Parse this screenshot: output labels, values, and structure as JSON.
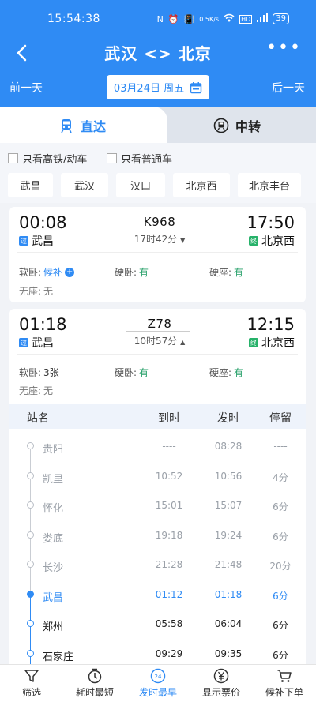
{
  "status_bar": {
    "time": "15:54:38",
    "icons": [
      "N",
      "⏰",
      "📳",
      "0.5K/s",
      "wifi",
      "HD",
      "4G"
    ],
    "battery": "39"
  },
  "header": {
    "title": "武汉 <> 北京",
    "back_icon": "back-arrow-icon",
    "more_icon": "more-dots-icon"
  },
  "date_bar": {
    "prev": "前一天",
    "date": "03月24日 周五",
    "next": "后一天"
  },
  "tabs": [
    {
      "label": "直达",
      "active": true
    },
    {
      "label": "中转",
      "active": false
    }
  ],
  "filters": [
    {
      "label": "只看高铁/动车"
    },
    {
      "label": "只看普通车"
    }
  ],
  "station_chips": [
    "武昌",
    "武汉",
    "汉口",
    "北京西",
    "北京丰台"
  ],
  "trains": [
    {
      "train_no": "K968",
      "dep_time": "00:08",
      "arr_time": "17:50",
      "dep_station": "武昌",
      "arr_station": "北京西",
      "duration": "17时42分",
      "dep_badge": "过",
      "arr_badge": "终",
      "expand_icon": "▼",
      "seats": [
        {
          "label": "软卧:",
          "value": "候补"
        },
        {
          "label": "硬卧:",
          "value": "有"
        },
        {
          "label": "硬座:",
          "value": "有"
        },
        {
          "label": "无座:",
          "value": "无"
        }
      ]
    },
    {
      "train_no": "Z78",
      "dep_time": "01:18",
      "arr_time": "12:15",
      "dep_station": "武昌",
      "arr_station": "北京西",
      "duration": "10时57分",
      "dep_badge": "过",
      "arr_badge": "终",
      "expand_icon": "▲",
      "seats": [
        {
          "label": "软卧:",
          "value": "3张"
        },
        {
          "label": "硬卧:",
          "value": "有"
        },
        {
          "label": "硬座:",
          "value": "有"
        },
        {
          "label": "无座:",
          "value": "无"
        }
      ]
    }
  ],
  "stops_table": {
    "headers": [
      "站名",
      "到时",
      "发时",
      "停留"
    ],
    "rows": [
      {
        "name": "贵阳",
        "arr": "----",
        "dep": "08:28",
        "stay": "----",
        "state": "past"
      },
      {
        "name": "凯里",
        "arr": "10:52",
        "dep": "10:56",
        "stay": "4分",
        "state": "past"
      },
      {
        "name": "怀化",
        "arr": "15:01",
        "dep": "15:07",
        "stay": "6分",
        "state": "past"
      },
      {
        "name": "娄底",
        "arr": "19:18",
        "dep": "19:24",
        "stay": "6分",
        "state": "past"
      },
      {
        "name": "长沙",
        "arr": "21:28",
        "dep": "21:48",
        "stay": "20分",
        "state": "past"
      },
      {
        "name": "武昌",
        "arr": "01:12",
        "dep": "01:18",
        "stay": "6分",
        "state": "current"
      },
      {
        "name": "郑州",
        "arr": "05:58",
        "dep": "06:04",
        "stay": "6分",
        "state": "future"
      },
      {
        "name": "石家庄",
        "arr": "09:29",
        "dep": "09:35",
        "stay": "6分",
        "state": "future"
      }
    ]
  },
  "bottom_bar": [
    {
      "label": "筛选",
      "icon": "filter-icon"
    },
    {
      "label": "耗时最短",
      "icon": "timer-icon"
    },
    {
      "label": "发时最早",
      "icon": "clock24-icon",
      "badge": "24",
      "active": true
    },
    {
      "label": "显示票价",
      "icon": "yen-icon"
    },
    {
      "label": "候补下单",
      "icon": "cart-icon"
    }
  ],
  "colors": {
    "primary": "#2f8bf4",
    "available": "#27a06a",
    "past": "#9aa0a8"
  }
}
